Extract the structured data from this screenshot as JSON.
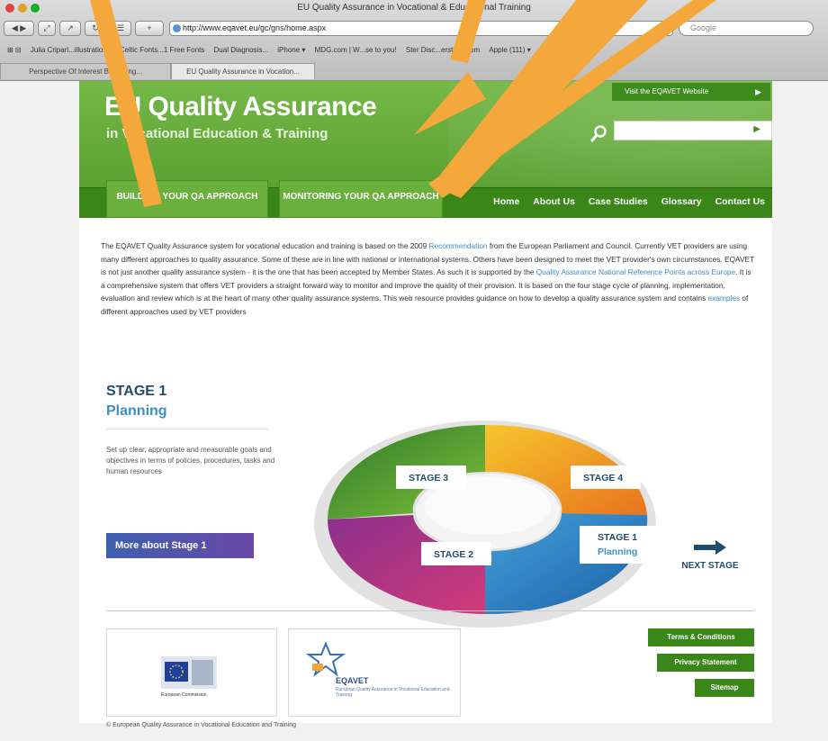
{
  "window": {
    "title": "EU Quality Assurance in Vocational & Educational Training"
  },
  "toolbar": {
    "url": "http://www.eqavet.eu/gc/gns/home.aspx",
    "search_placeholder": "Google"
  },
  "bookmarks": [
    "Julia Criparl...illustrations",
    "Celtic Fonts...1 Free Fonts",
    "Dual Diagnosis...",
    "iPhone ▾",
    "MDG.com | W...se to you!",
    "Ster Disc...erstock.com",
    "Apple (111) ▾"
  ],
  "tabs": [
    {
      "label": "Perspective Of Interest Becoming..."
    },
    {
      "label": "EU Quality Assurance in Vocation..."
    }
  ],
  "header": {
    "title": "EU Quality Assurance",
    "subtitle": "in Vocational Education & Training",
    "visit_label": "Visit the EQAVET Website",
    "search_placeholder": ""
  },
  "qa_tabs": [
    {
      "label": "BUILDING YOUR QA APPROACH"
    },
    {
      "label": "MONITORING YOUR QA APPROACH"
    }
  ],
  "menu": [
    "Home",
    "About Us",
    "Case Studies",
    "Glossary",
    "Contact Us"
  ],
  "intro": {
    "p1": "The EQAVET Quality Assurance system for vocational education and training is based on the 2009 ",
    "link1": "Recommendation",
    "p2": " from the European Parliament and Council. Currently VET providers are using many different approaches to quality assurance. Some of these are in line with national or international systems. Others have been designed to meet the VET provider's own circumstances. EQAVET is not just another quality assurance system - it is the one that has been accepted by Member States. As such it is supported by the ",
    "link2": "Quality Assurance National Reference Points across Europe",
    "p3": ". It is a comprehensive system that offers VET providers a straight forward way to monitor and improve the quality of their provision. It is based on the four stage cycle of planning, implementation, evaluation and review which is at the heart of many other quality assurance systems. This web resource provides guidance on how to develop a quality assurance system and contains ",
    "link3": "examples",
    "p4": " of different approaches used by VET providers"
  },
  "stage_panel": {
    "heading": "STAGE 1",
    "subheading": "Planning",
    "text": "Set up clear, appropriate and measurable goals and objectives in terms of policies, procedures, tasks and human resources",
    "button": "More about Stage 1"
  },
  "cycle": {
    "stage3": "STAGE 3",
    "stage4": "STAGE 4",
    "stage2": "STAGE 2",
    "stage1": "STAGE 1",
    "stage1_sub": "Planning",
    "next_label": "NEXT STAGE"
  },
  "footer": {
    "ec_text": "European Commission",
    "eqavet_name": "EQAVET",
    "eqavet_small": "European Quality Assurance in Vocational Education and Training",
    "links": [
      "Terms & Conditions",
      "Privacy Statement",
      "Sitemap"
    ],
    "copyright": "© European Quality Assurance in Vocational Education and Training"
  },
  "colors": {
    "header_green": "#6db540",
    "nav_green": "#3b8618",
    "arrow_orange": "#f4a73a"
  }
}
